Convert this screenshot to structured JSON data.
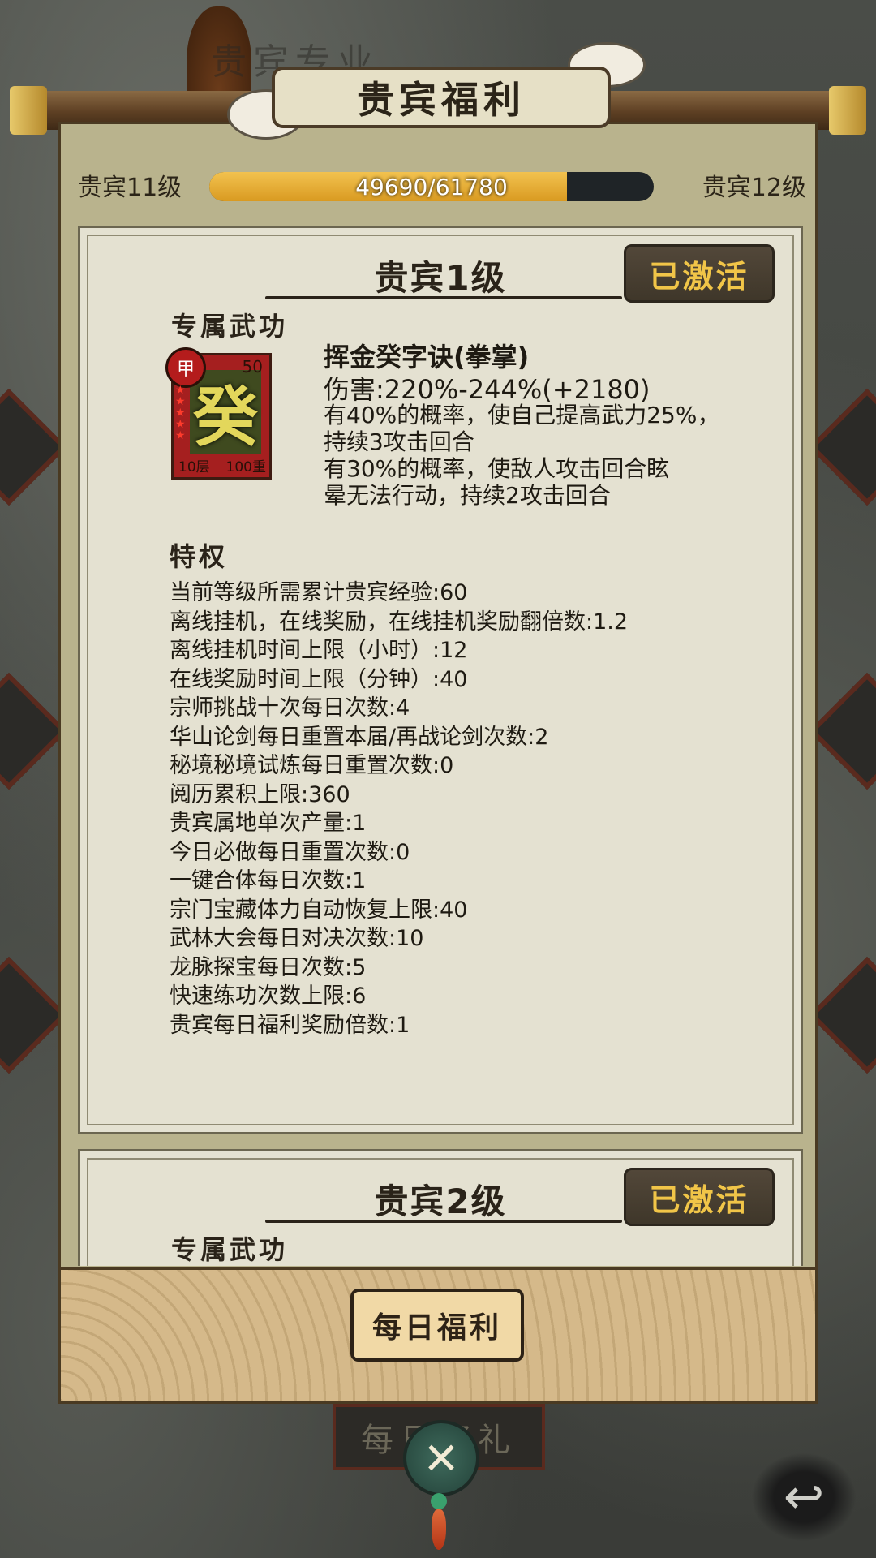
{
  "header": {
    "title": "贵宾福利",
    "shade_title": "贵宾专业"
  },
  "level_bar": {
    "current_level_label": "贵宾11级",
    "next_level_label": "贵宾12级",
    "progress_text": "49690/61780",
    "progress_fraction": 0.804
  },
  "cards": [
    {
      "title": "贵宾1级",
      "status": "已激活",
      "exclusive_skill_label": "专属武功",
      "skill": {
        "icon_char": "癸",
        "grade": "甲",
        "level_num": "50",
        "layer": "10层",
        "weight": "100重",
        "name": "挥金癸字诀(拳掌)",
        "damage": "伤害:220%-244%(+2180)",
        "desc_lines": [
          "有40%的概率，使自己提高武力25%，",
          "持续3攻击回合",
          "有30%的概率，使敌人攻击回合眩",
          "晕无法行动，持续2攻击回合"
        ]
      },
      "privilege_label": "特权",
      "privileges": [
        "当前等级所需累计贵宾经验:60",
        "离线挂机，在线奖励，在线挂机奖励翻倍数:1.2",
        "离线挂机时间上限（小时）:12",
        "在线奖励时间上限（分钟）:40",
        "宗师挑战十次每日次数:4",
        "华山论剑每日重置本届/再战论剑次数:2",
        "秘境秘境试炼每日重置次数:0",
        "阅历累积上限:360",
        "贵宾属地单次产量:1",
        "今日必做每日重置次数:0",
        "一键合体每日次数:1",
        "宗门宝藏体力自动恢复上限:40",
        "武林大会每日对决次数:10",
        "龙脉探宝每日次数:5",
        "快速练功次数上限:6",
        "贵宾每日福利奖励倍数:1"
      ]
    },
    {
      "title": "贵宾2级",
      "status": "已激活",
      "exclusive_skill_label": "专属武功"
    }
  ],
  "footer": {
    "daily_button": "每日福利",
    "sign_text": "每日好礼",
    "close_glyph": "✕",
    "back_glyph": "↩"
  },
  "colors": {
    "accent_gold": "#f1c548",
    "paper": "#e4e1d1",
    "frame": "#b9b38d",
    "progress_fill": "#f2c24f"
  }
}
